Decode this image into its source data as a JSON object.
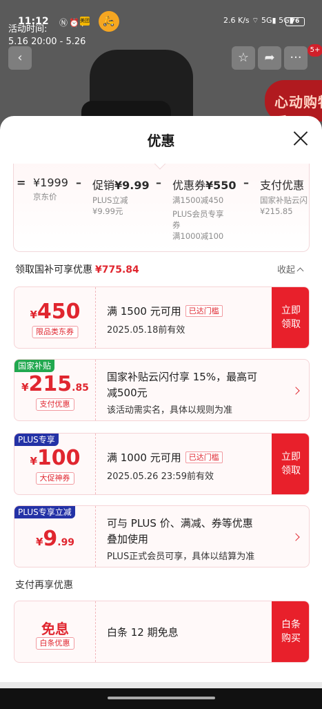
{
  "status_bar": {
    "time": "11:12",
    "speed_top": "2.6",
    "speed_unit": "K/s",
    "battery": "76"
  },
  "background": {
    "activity_label": "活动时间:",
    "activity_time": "5.16 20:00 - 5.26",
    "badge_count": "5+",
    "promo_text": "心动购物季"
  },
  "sheet": {
    "title": "优惠"
  },
  "formula": {
    "equals": "=",
    "minus": "–",
    "price": {
      "amount": "¥1999",
      "label": "京东价"
    },
    "promo": {
      "name": "促销",
      "amount": "¥9.99",
      "line1": "PLUS立减",
      "line2": "¥9.99元"
    },
    "coupon": {
      "name": "优惠券",
      "amount": "¥550",
      "line1": "满1500减450",
      "line2": "PLUS会员专享",
      "line3": "券",
      "line4": "满1000减100"
    },
    "pay": {
      "name": "支付优惠",
      "line1": "国家补贴云闪",
      "line2": "¥215.85"
    }
  },
  "summary": {
    "label": "领取国补可享优惠",
    "amount": "¥775.84",
    "collapse_label": "收起"
  },
  "coupons": [
    {
      "badge": "",
      "currency": "¥",
      "value": "450",
      "decimal": "",
      "tag": "限品类东券",
      "line1": "满 1500 元可用",
      "met_tag": "已达门槛",
      "line2": "2025.05.18前有效",
      "action": "立即领取"
    },
    {
      "badge": "国家补贴",
      "currency": "¥",
      "value": "215",
      "decimal": ".85",
      "tag": "支付优惠",
      "line1": "国家补贴云闪付享 15%，最高可",
      "line1b": "减500元",
      "line2": "该活动需实名，具体以规则为准"
    },
    {
      "badge": "PLUS专享",
      "currency": "¥",
      "value": "100",
      "decimal": "",
      "tag": "大促神券",
      "line1": "满 1000 元可用",
      "met_tag": "已达门槛",
      "line2": "2025.05.26 23:59前有效",
      "action": "立即领取"
    },
    {
      "badge": "PLUS专享立减",
      "currency": "¥",
      "value": "9",
      "decimal": ".99",
      "line1": "可与 PLUS 价、满减、券等优惠",
      "line1b": "叠加使用",
      "line2": "PLUS正式会员可享，具体以结算为准"
    }
  ],
  "payment_section": {
    "label": "支付再享优惠",
    "card": {
      "title": "免息",
      "tag": "白条优惠",
      "text": "白条 12 期免息",
      "action": "白条购买"
    }
  },
  "colors": {
    "accent": "#e0262f",
    "claim_button": "#e8202b",
    "badge_green": "#21a84f",
    "badge_blue": "#2332a6"
  }
}
